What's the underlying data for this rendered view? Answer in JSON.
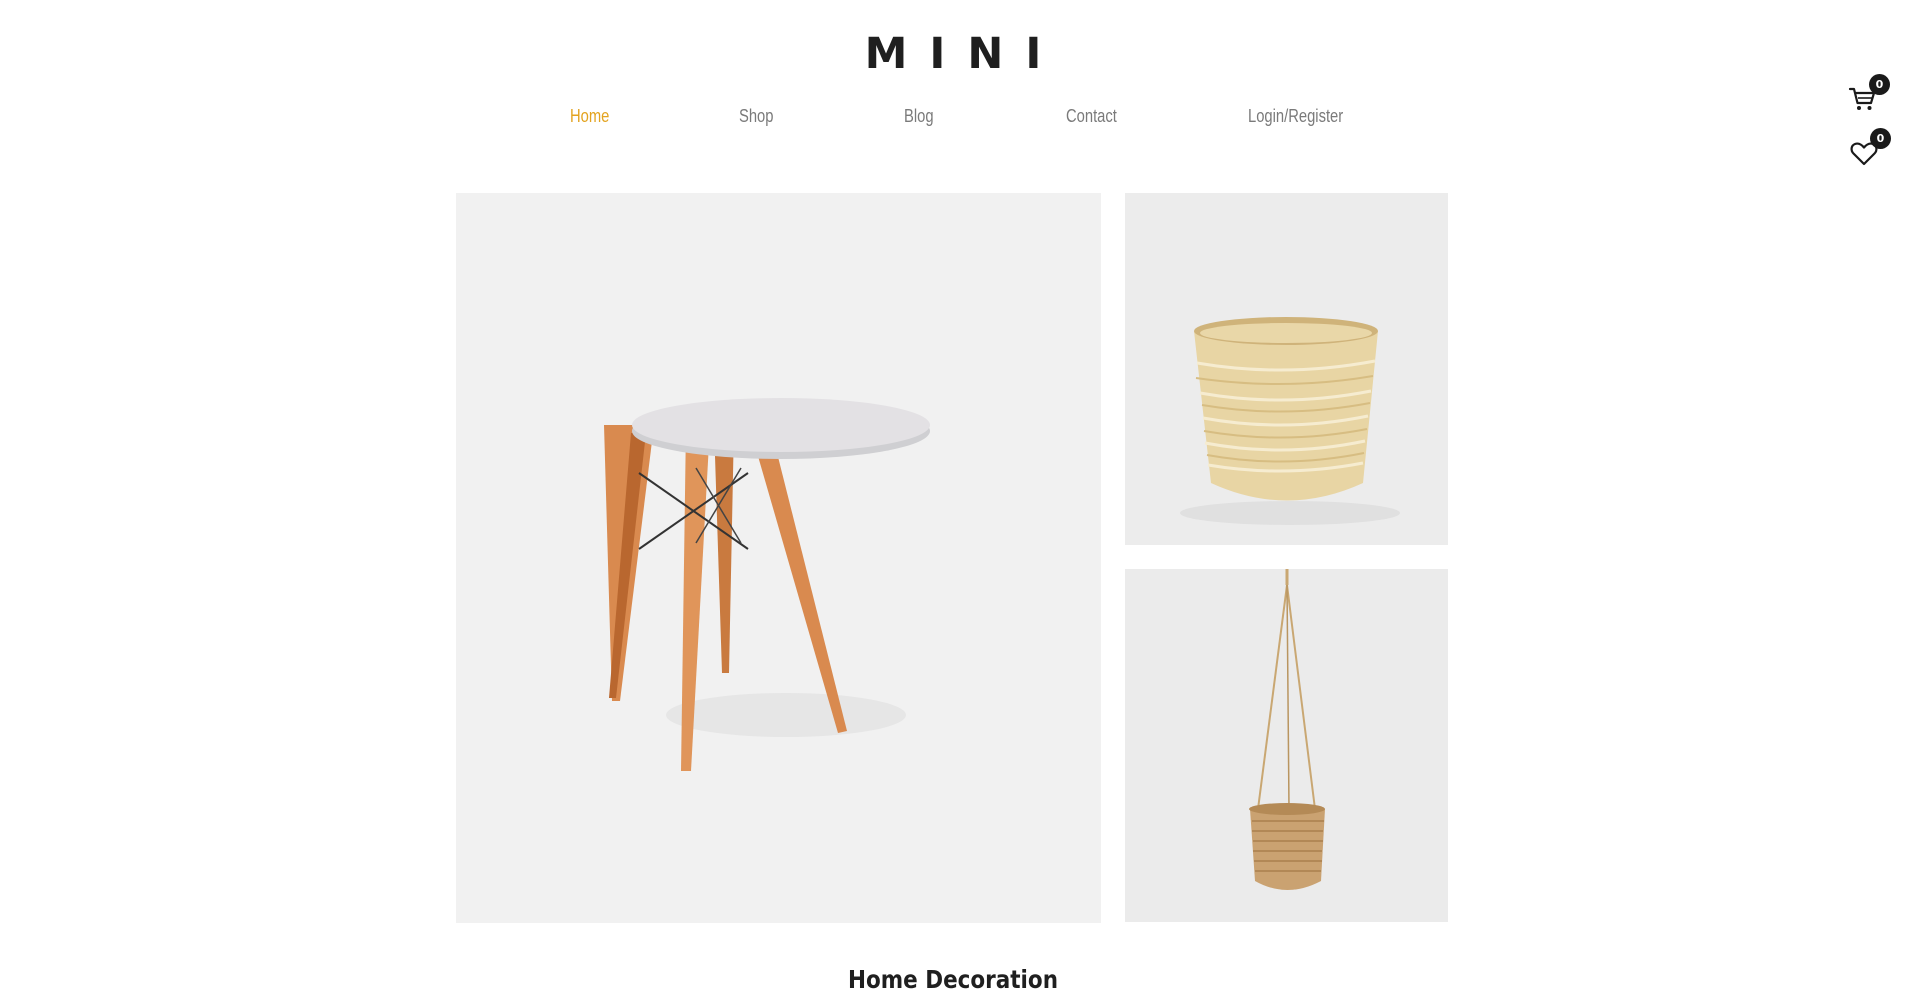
{
  "brand": {
    "logo_text": "MINI"
  },
  "nav": {
    "items": [
      {
        "label": "Home",
        "active": true
      },
      {
        "label": "Shop",
        "active": false
      },
      {
        "label": "Blog",
        "active": false
      },
      {
        "label": "Contact",
        "active": false
      },
      {
        "label": "Login/Register",
        "active": false
      }
    ]
  },
  "header_icons": {
    "cart": {
      "icon": "cart-icon",
      "count": "0"
    },
    "wishlist": {
      "icon": "heart-icon",
      "count": "0"
    }
  },
  "gallery": {
    "items": [
      {
        "name": "round-table",
        "icon": "table-image"
      },
      {
        "name": "bamboo-bowl",
        "icon": "bowl-image"
      },
      {
        "name": "hanging-basket",
        "icon": "basket-image"
      }
    ]
  },
  "sections": {
    "home_decoration_title": "Home Decoration"
  },
  "colors": {
    "accent": "#e3a31f",
    "nav_text": "#7a7a7a",
    "heading": "#1f1f1f",
    "badge_bg": "#1a1a1a"
  }
}
